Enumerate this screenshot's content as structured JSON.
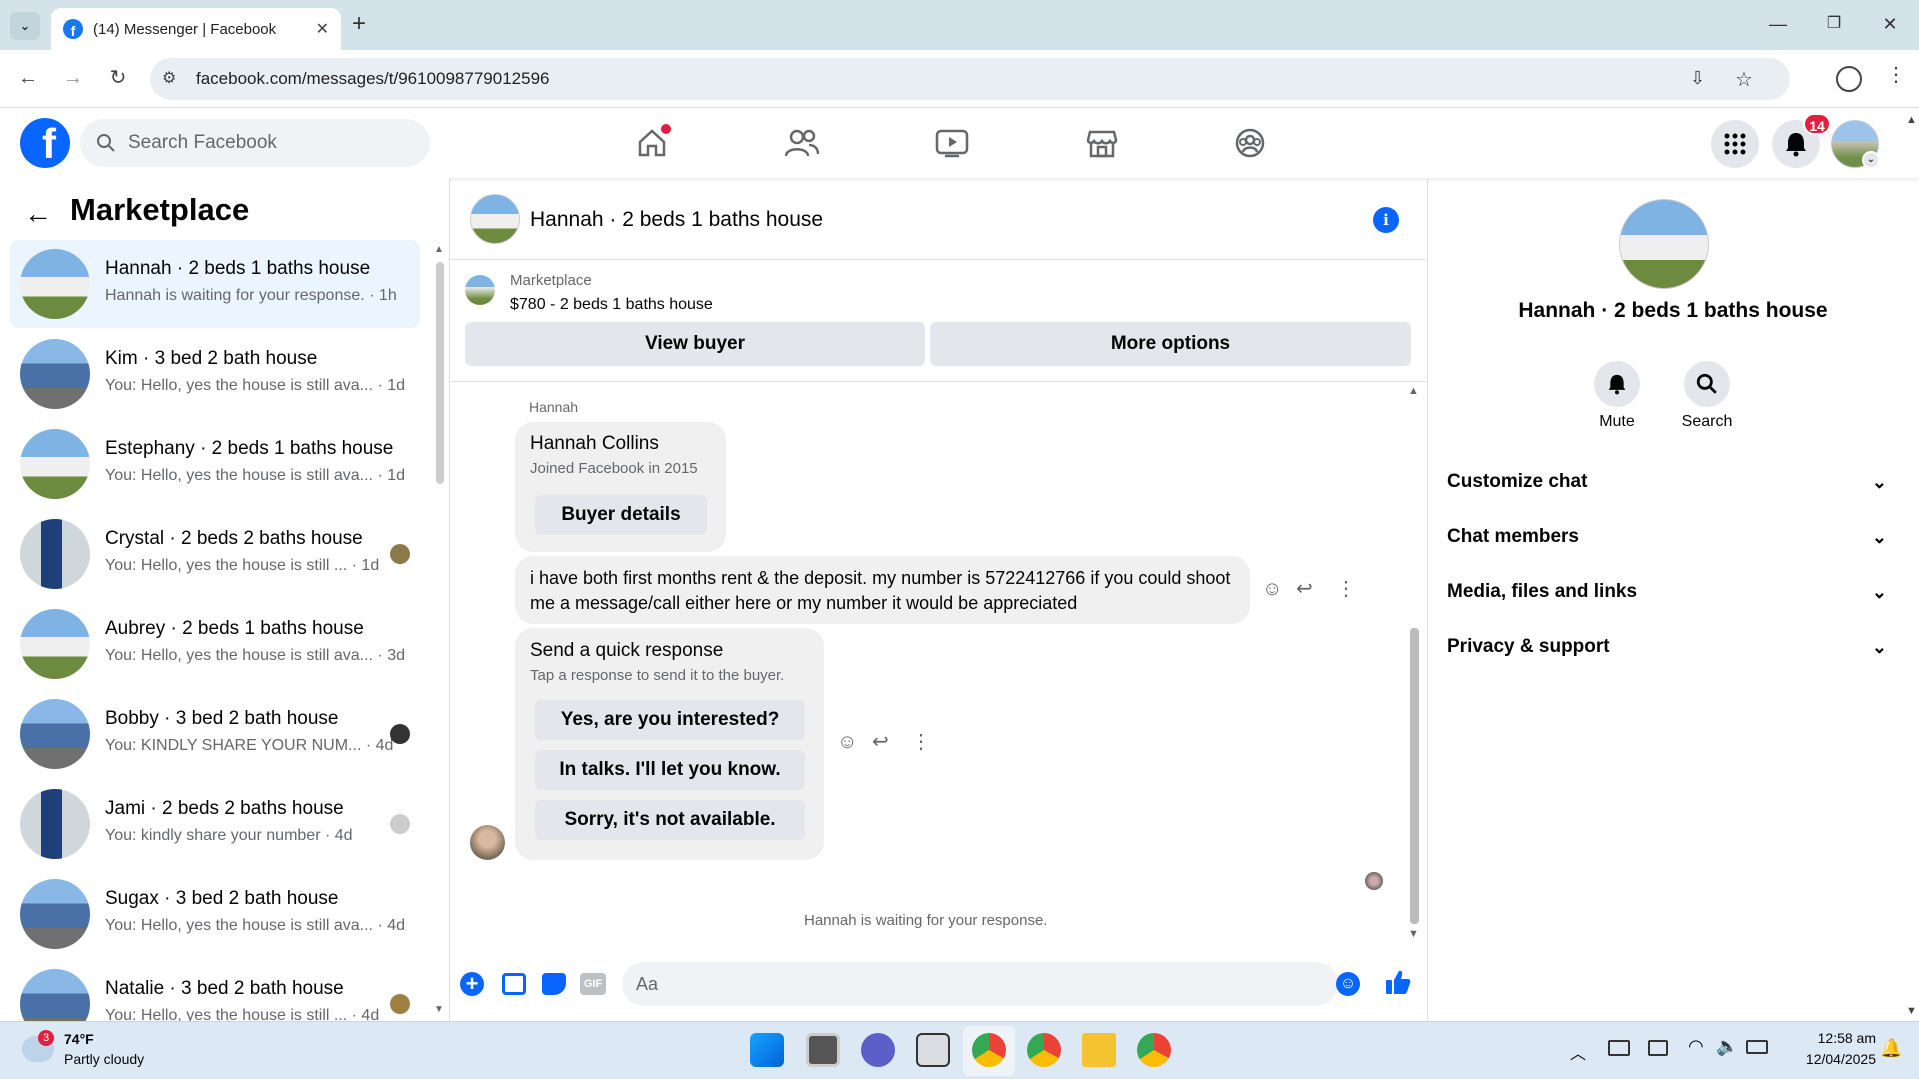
{
  "browser": {
    "tab_title": "(14) Messenger | Facebook",
    "url": "facebook.com/messages/t/9610098779012596"
  },
  "header": {
    "search_placeholder": "Search Facebook",
    "notification_count": "14"
  },
  "left_panel": {
    "title": "Marketplace",
    "conversations": [
      {
        "name": "Hannah · 2 beds 1 baths house",
        "preview": "Hannah is waiting for your response. · 1h",
        "selected": true
      },
      {
        "name": "Kim · 3 bed 2 bath house",
        "preview": "You: Hello, yes the house is still ava... · 1d"
      },
      {
        "name": "Estephany · 2 beds 1 baths house",
        "preview": "You: Hello, yes the house is still ava... · 1d"
      },
      {
        "name": "Crystal · 2 beds 2 baths house",
        "preview": "You: Hello, yes the house is still ... · 1d"
      },
      {
        "name": "Aubrey · 2 beds 1 baths house",
        "preview": "You: Hello, yes the house is still ava... · 3d"
      },
      {
        "name": "Bobby · 3 bed 2 bath house",
        "preview": "You: KINDLY SHARE YOUR NUM... · 4d"
      },
      {
        "name": "Jami · 2 beds 2 baths house",
        "preview": "You: kindly share your number · 4d"
      },
      {
        "name": "Sugax · 3 bed 2 bath house",
        "preview": "You: Hello, yes the house is still ava... · 4d"
      },
      {
        "name": "Natalie · 3 bed 2 bath house",
        "preview": "You: Hello, yes the house is still ... · 4d"
      }
    ]
  },
  "chat": {
    "title": "Hannah · 2 beds 1 baths house",
    "marketplace_label": "Marketplace",
    "listing": "$780 - 2 beds 1 baths house",
    "view_buyer": "View buyer",
    "more_options": "More options",
    "sender_label": "Hannah",
    "profile_card": {
      "name": "Hannah Collins",
      "joined": "Joined Facebook in 2015",
      "button": "Buyer details"
    },
    "message": "i have both first months rent & the deposit. my number is 5722412766 if you could shoot me a message/call either here or my number it would be appreciated",
    "quick_response": {
      "title": "Send a quick response",
      "subtitle": "Tap a response to send it to the buyer.",
      "options": [
        "Yes, are you interested?",
        "In talks. I'll let you know.",
        "Sorry, it's not available."
      ]
    },
    "waiting_status": "Hannah is waiting for your response.",
    "composer_placeholder": "Aa"
  },
  "right_panel": {
    "name": "Hannah · 2 beds 1 baths house",
    "mute_label": "Mute",
    "search_label": "Search",
    "sections": [
      "Customize chat",
      "Chat members",
      "Media, files and links",
      "Privacy & support"
    ]
  },
  "taskbar": {
    "temperature": "74°F",
    "weather": "Partly cloudy",
    "weather_badge": "3",
    "time": "12:58 am",
    "date": "12/04/2025"
  },
  "colors": {
    "fb_blue": "#0866ff",
    "notification_red": "#e41e3f",
    "selected_row": "#ebf5ff"
  }
}
